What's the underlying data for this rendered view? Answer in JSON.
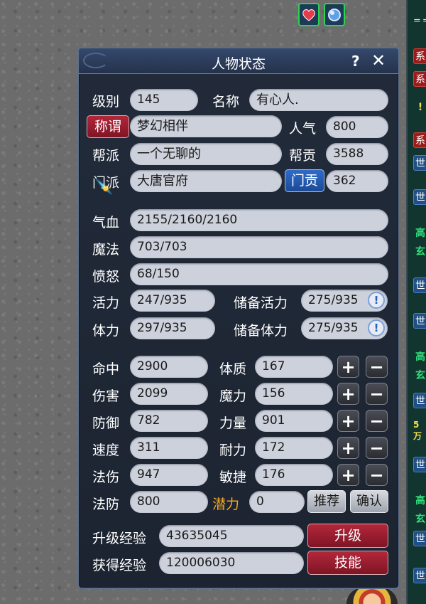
{
  "window": {
    "title": "人物状态",
    "help": "?",
    "close": "✕"
  },
  "basic": {
    "level_label": "级别",
    "level": "145",
    "name_label": "名称",
    "name": "有心人.",
    "title_button": "称谓",
    "title_value": "梦幻相伴",
    "popularity_label": "人气",
    "popularity": "800",
    "guild_label": "帮派",
    "guild": "一个无聊的",
    "guild_contrib_label": "帮贡",
    "guild_contrib": "3588",
    "sect_label": "门派",
    "sect": "大唐官府",
    "sect_contrib_button": "门贡",
    "sect_contrib": "362"
  },
  "vitals": {
    "hp_label": "气血",
    "hp": "2155/2160/2160",
    "mp_label": "魔法",
    "mp": "703/703",
    "rage_label": "愤怒",
    "rage": "68/150",
    "vitality_label": "活力",
    "vitality": "247/935",
    "reserve_vitality_label": "储备活力",
    "reserve_vitality": "275/935",
    "stamina_label": "体力",
    "stamina": "297/935",
    "reserve_stamina_label": "储备体力",
    "reserve_stamina": "275/935"
  },
  "combat": {
    "hit_label": "命中",
    "hit": "2900",
    "damage_label": "伤害",
    "damage": "2099",
    "defense_label": "防御",
    "defense": "782",
    "speed_label": "速度",
    "speed": "311",
    "magic_dmg_label": "法伤",
    "magic_dmg": "947",
    "magic_def_label": "法防",
    "magic_def": "800"
  },
  "attributes": {
    "con_label": "体质",
    "con": "167",
    "mag_label": "魔力",
    "mag": "156",
    "str_label": "力量",
    "str": "901",
    "end_label": "耐力",
    "end": "172",
    "agi_label": "敏捷",
    "agi": "176",
    "potential_label": "潜力",
    "potential": "0",
    "recommend_button": "推荐",
    "confirm_button": "确认",
    "plus": "+",
    "minus": "−"
  },
  "experience": {
    "upgrade_exp_label": "升级经验",
    "upgrade_exp": "43635045",
    "gained_exp_label": "获得经验",
    "gained_exp": "120006030",
    "upgrade_button": "升级",
    "skills_button": "技能"
  },
  "right_strip": {
    "top_text": "==",
    "chip_labels": [
      "系",
      "系",
      "!",
      "系",
      "世",
      "世",
      "高",
      "玄",
      "世",
      "世",
      "高",
      "玄",
      "世",
      "5万",
      "世",
      "高",
      "玄",
      "世",
      "世"
    ]
  },
  "colors": {
    "accent_red": "#9c1b2b",
    "accent_blue": "#2f6bc9",
    "panel_bg": "#1f2734",
    "potential_orange": "#f5a623"
  },
  "info_icon": "!"
}
